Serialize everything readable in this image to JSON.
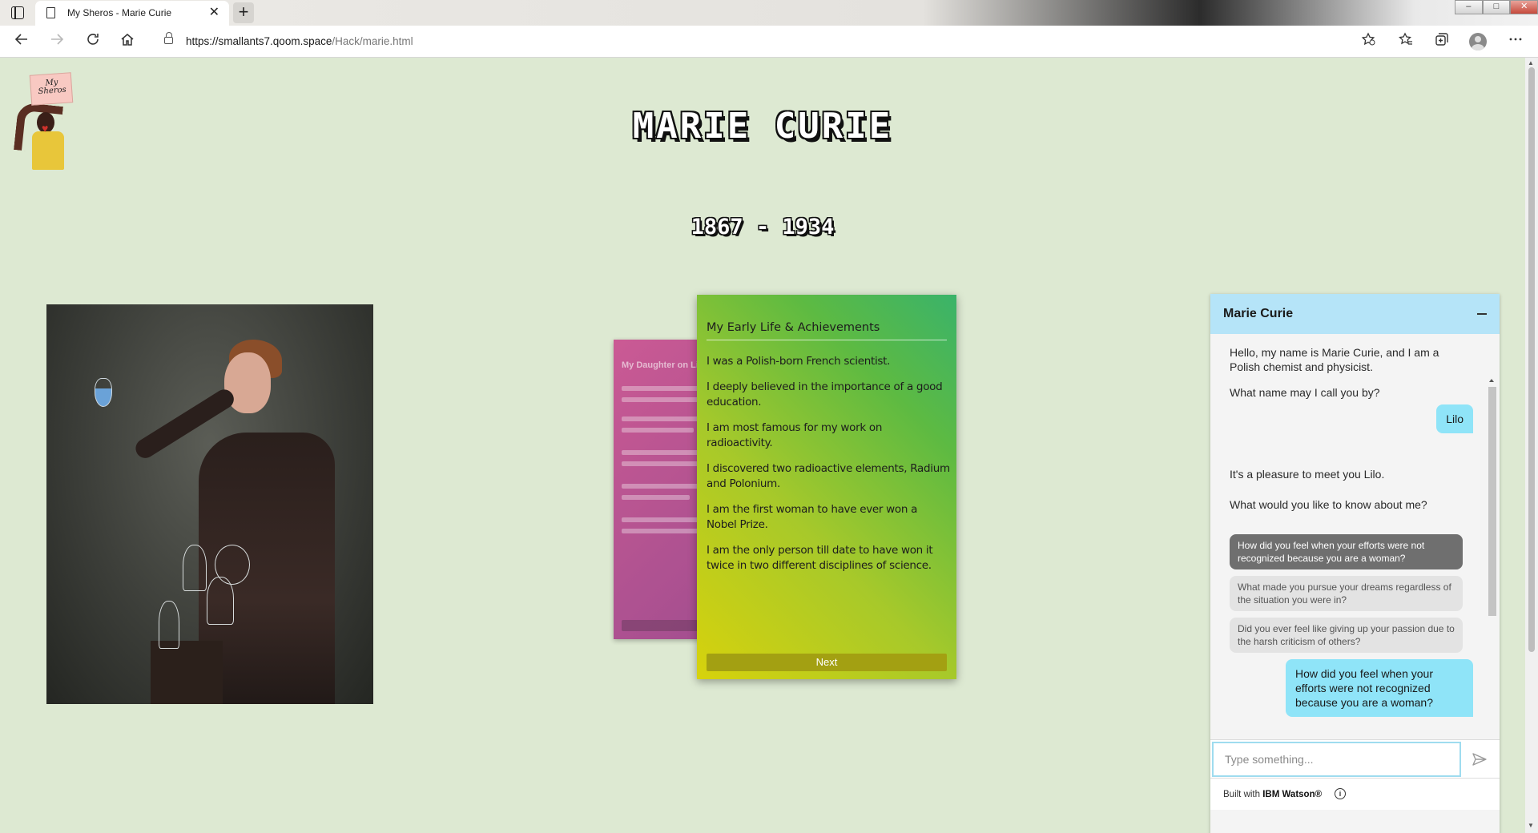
{
  "browser": {
    "tab_title": "My Sheros - Marie Curie",
    "tab_close": "✕",
    "new_tab": "+",
    "url_host": "https://smallants7.qoom.space",
    "url_path": "/Hack/marie.html",
    "icons": [
      "back-icon",
      "forward-icon",
      "refresh-icon",
      "home-icon",
      "lock-icon",
      "add-favorite-icon",
      "favorites-icon",
      "collections-icon",
      "profile-icon",
      "more-icon"
    ]
  },
  "logo": {
    "sign_text": "My Sheros"
  },
  "header": {
    "title": "MARIE CURIE",
    "dates": "1867 - 1934"
  },
  "card_back": {
    "title": "My Daughter on Life"
  },
  "card": {
    "heading": "My Early Life & Achievements",
    "facts": [
      "I was a Polish-born French scientist.",
      "I deeply believed in the importance of a good education.",
      "I am most famous for my work on radioactivity.",
      "I discovered two radioactive elements, Radium and Polonium.",
      "I am the first woman to have ever won a Nobel Prize.",
      "I am the only person till date to have won it twice in two different disciplines of science."
    ],
    "next_label": "Next",
    "colors": {
      "start": "#d7d20c",
      "end": "#3ab36a"
    }
  },
  "chat": {
    "title": "Marie Curie",
    "messages": {
      "greeting": "Hello, my name is Marie Curie, and I am a Polish chemist and physicist.",
      "ask_name": "What name may I call you by?",
      "user_name": "Lilo",
      "pleasure": "It's a pleasure to meet you Lilo.",
      "ask_topic": "What would you like to know about me?",
      "user_question": "How did you feel when your efforts were not recognized because you are a woman?"
    },
    "options": [
      {
        "label": "How did you feel when your efforts were not recognized because you are a woman?",
        "selected": true
      },
      {
        "label": "What made you pursue your dreams regardless of the situation you were in?",
        "selected": false
      },
      {
        "label": "Did you ever feel like giving up your passion due to the harsh criticism of others?",
        "selected": false
      }
    ],
    "input_placeholder": "Type something...",
    "footer_prefix": "Built with ",
    "footer_brand": "IBM Watson®",
    "colors": {
      "header": "#b5e4f8",
      "user_bubble": "#8fe4f8"
    }
  }
}
